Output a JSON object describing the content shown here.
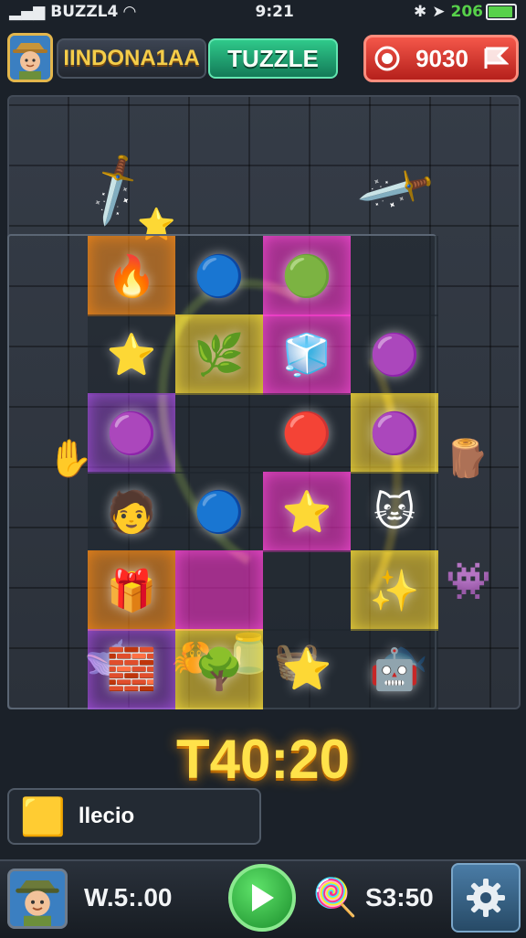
{
  "status_bar": {
    "carrier": "BUZZL4",
    "time": "9:21",
    "battery_text": "206"
  },
  "header": {
    "player_name": "IINDONA1AA",
    "game_title": "TUZZLE",
    "timer_value": "9030"
  },
  "board": {
    "rows": [
      [
        {
          "icon": "🔥",
          "glow": "orange"
        },
        {
          "icon": "🔵",
          "glow": "dark"
        },
        {
          "icon": "🟢",
          "glow": "pink"
        },
        {
          "icon": "",
          "glow": "dark"
        }
      ],
      [
        {
          "icon": "⭐",
          "glow": "dark"
        },
        {
          "icon": "🌿",
          "glow": "yellow"
        },
        {
          "icon": "🧊",
          "glow": "pink"
        },
        {
          "icon": "🟣",
          "glow": "dark"
        }
      ],
      [
        {
          "icon": "🟣",
          "glow": "purple"
        },
        {
          "icon": "",
          "glow": "dark"
        },
        {
          "icon": "🔴",
          "glow": "dark"
        },
        {
          "icon": "🟣",
          "glow": "yellow"
        }
      ],
      [
        {
          "icon": "🧑",
          "glow": "dark"
        },
        {
          "icon": "🔵",
          "glow": "dark"
        },
        {
          "icon": "⭐",
          "glow": "pink"
        },
        {
          "icon": "🐱",
          "glow": "dark"
        }
      ],
      [
        {
          "icon": "🎁",
          "glow": "orange"
        },
        {
          "icon": "",
          "glow": "pink"
        },
        {
          "icon": "",
          "glow": "dark"
        },
        {
          "icon": "✨",
          "glow": "yellow"
        }
      ],
      [
        {
          "icon": "🧱",
          "glow": "purple"
        },
        {
          "icon": "🌳",
          "glow": "yellow"
        },
        {
          "icon": "⭐",
          "glow": "dark"
        },
        {
          "icon": "🤖",
          "glow": "dark"
        }
      ]
    ]
  },
  "big_timer": "T40:20",
  "hint": {
    "label": "llecio"
  },
  "bottom_bar": {
    "score_left": "W.5:.00",
    "score_right": "S3:50"
  }
}
